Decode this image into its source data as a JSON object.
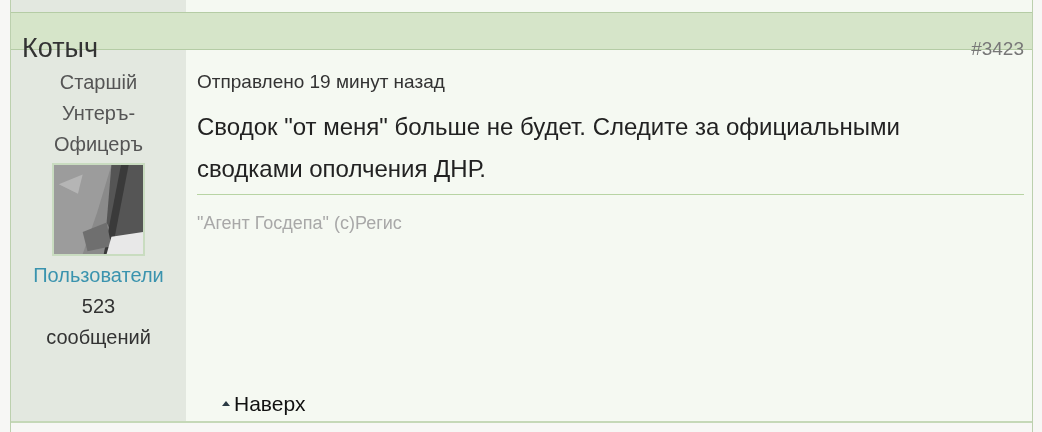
{
  "post": {
    "author": "Котыч",
    "number": "#3423",
    "rank": "Старшій Унтеръ-Офицеръ",
    "group": "Пользователи",
    "post_count": "523",
    "post_count_label": "сообщений",
    "posted": "Отправлено 19 минут назад",
    "message": "Сводок \"от меня\" больше не будет. Следите за официальными сводками ополчения ДНР.",
    "signature": "\"Агент Госдепа\" (c)Регис",
    "back_to_top": "Наверх"
  }
}
